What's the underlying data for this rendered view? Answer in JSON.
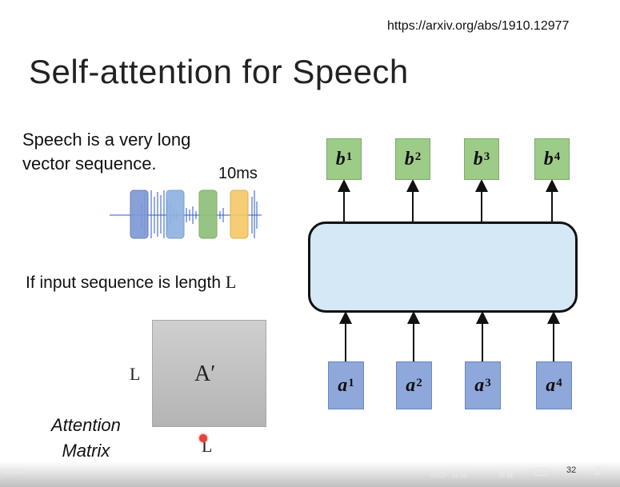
{
  "url": "https://arxiv.org/abs/1910.12977",
  "title": "Self-attention for Speech",
  "speech_text_line1": "Speech is a very long",
  "speech_text_line2": "vector sequence.",
  "duration_label": "10ms",
  "input_text": "If input sequence is length ",
  "input_length_symbol": "L",
  "matrix_label": "A′",
  "matrix_side_left": "L",
  "matrix_side_bottom": "L",
  "attention_label_line1": "Attention",
  "attention_label_line2": "Matrix",
  "outputs": [
    {
      "base": "b",
      "sup": "1"
    },
    {
      "base": "b",
      "sup": "2"
    },
    {
      "base": "b",
      "sup": "3"
    },
    {
      "base": "b",
      "sup": "4"
    }
  ],
  "inputs": [
    {
      "base": "a",
      "sup": "1"
    },
    {
      "base": "a",
      "sup": "2"
    },
    {
      "base": "a",
      "sup": "3"
    },
    {
      "base": "a",
      "sup": "4"
    }
  ],
  "colors": {
    "output_box": "#9dcb88",
    "input_box": "#8ea8db",
    "attention_block": "#d5e8f5",
    "waveform": "#2b55d6",
    "frame_blue": "#7e9ad6",
    "frame_lightblue": "#8fb3e0",
    "frame_green": "#8fc07a",
    "frame_yellow": "#f5c96a"
  },
  "video_controls": {
    "page_number": "32",
    "left_text": "45:06",
    "quality": "480P 标清",
    "danmaku": "弹幕"
  }
}
